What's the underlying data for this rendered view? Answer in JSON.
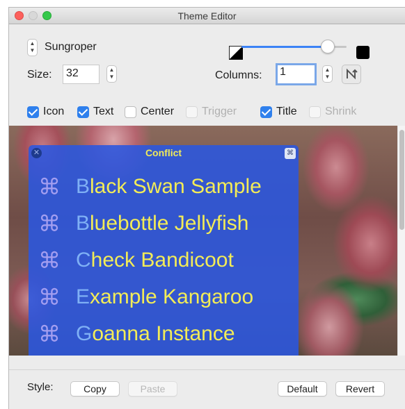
{
  "window": {
    "title": "Theme Editor"
  },
  "theme": {
    "selected": "Sungroper"
  },
  "size": {
    "label": "Size:",
    "value": "32"
  },
  "columns": {
    "label": "Columns:",
    "value": "1"
  },
  "opacity_slider": {
    "value_fraction": 0.82
  },
  "checkboxes": [
    {
      "label": "Icon",
      "checked": true,
      "enabled": true
    },
    {
      "label": "Text",
      "checked": true,
      "enabled": true
    },
    {
      "label": "Center",
      "checked": false,
      "enabled": true
    },
    {
      "label": "Trigger",
      "checked": false,
      "enabled": false
    },
    {
      "label": "Title",
      "checked": true,
      "enabled": true
    },
    {
      "label": "Shrink",
      "checked": false,
      "enabled": false
    }
  ],
  "preview": {
    "title": "Conflict",
    "command_glyph": "⌘",
    "items": [
      {
        "first": "B",
        "rest": "lack Swan Sample"
      },
      {
        "first": "B",
        "rest": "luebottle Jellyfish"
      },
      {
        "first": "C",
        "rest": "heck Bandicoot"
      },
      {
        "first": "E",
        "rest": "xample Kangaroo"
      },
      {
        "first": "G",
        "rest": "oanna Instance"
      }
    ]
  },
  "footer": {
    "style_label": "Style:",
    "copy": "Copy",
    "paste": "Paste",
    "default": "Default",
    "revert": "Revert"
  },
  "colors": {
    "accent": "#2f80ed",
    "hud_background": "#2a56e0",
    "hud_text": "#f3ec57",
    "hud_first_letter": "#7fb0f5",
    "hud_command_icon": "#a39ef0"
  }
}
